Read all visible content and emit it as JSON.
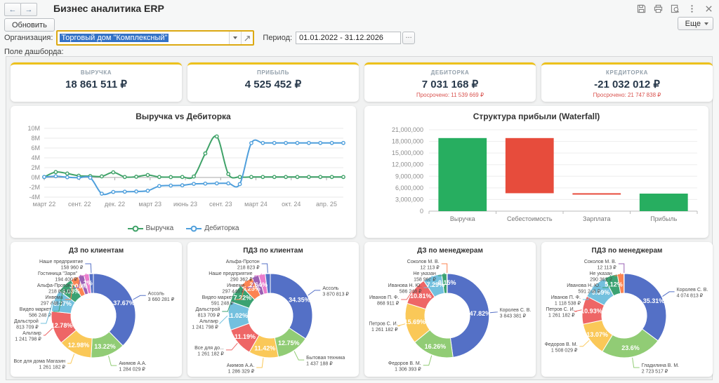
{
  "window": {
    "title": "Бизнес аналитика ERP",
    "back_glyph": "←",
    "forward_glyph": "→",
    "icons": [
      "save-icon",
      "print-icon",
      "preview-icon",
      "more-dots-icon",
      "close-icon"
    ]
  },
  "actions": {
    "refresh_label": "Обновить",
    "more_label": "Еще",
    "ellipsis_glyph": "..."
  },
  "filters": {
    "organization_label": "Организация:",
    "organization_value": "Торговый дом \"Комплексный\"",
    "period_label": "Период:",
    "period_value": "01.01.2022 - 31.12.2026"
  },
  "dashboard_area_label": "Поле дашборда:",
  "kpis": [
    {
      "label": "ВЫРУЧКА",
      "value": "18 861 511 ₽",
      "overdue": ""
    },
    {
      "label": "ПРИБЫЛЬ",
      "value": "4 525 452 ₽",
      "overdue": ""
    },
    {
      "label": "ДЕБИТОРКА",
      "value": "7 031 168 ₽",
      "overdue": "Просрочено: 11 539 669 ₽"
    },
    {
      "label": "КРЕДИТОРКА",
      "value": "-21 032 012 ₽",
      "overdue": "Просрочено: 21 747 838 ₽"
    }
  ],
  "colors": {
    "accent_yellow": "#edc11c",
    "kpi_value": "#28394b",
    "overdue_red": "#d9534f",
    "positive_green": "#27ae60",
    "negative_red": "#e74c3c",
    "line_green": "#3fa268",
    "line_blue": "#4f9fdc",
    "palette": [
      "#5470c6",
      "#91cc75",
      "#fac858",
      "#ee6666",
      "#73c0de",
      "#3ba272",
      "#fc8452",
      "#9a60b4",
      "#ea7ccc"
    ]
  },
  "chart_data": [
    {
      "type": "line",
      "title": "Выручка vs Дебиторка",
      "unit": "millions ₽",
      "ylim": [
        -4,
        10
      ],
      "y_ticks": [
        10,
        8,
        6,
        4,
        2,
        0,
        -2,
        -4
      ],
      "x_tick_labels": [
        "март 22",
        "сент. 22",
        "дек. 22",
        "март 23",
        "июнь 23",
        "сент. 23",
        "март 24",
        "окт. 24",
        "апр. 25"
      ],
      "legend_position": "bottom",
      "series": [
        {
          "name": "Выручка",
          "color_key": "line_green",
          "values": [
            0.1,
            1.1,
            0.8,
            0.35,
            0.28,
            0.22,
            1.05,
            0.1,
            0.15,
            0.5,
            0.1,
            0.08,
            0.1,
            0.2,
            4.9,
            8.35,
            0.7,
            0.1,
            0.1,
            0.1,
            0.1,
            0.1,
            0.1,
            0.1,
            0.1,
            0.1,
            0.1
          ]
        },
        {
          "name": "Дебиторка",
          "color_key": "line_blue",
          "values": [
            0.1,
            0.25,
            0.05,
            -0.05,
            -0.05,
            -3.3,
            -2.95,
            -2.9,
            -2.85,
            -2.7,
            -1.75,
            -1.65,
            -1.6,
            -1.3,
            -1.25,
            -1.2,
            -1.2,
            -1.35,
            7.0,
            7.03,
            7.03,
            7.03,
            7.03,
            7.03,
            7.03,
            7.03,
            7.03
          ]
        }
      ]
    },
    {
      "type": "bar",
      "subtype": "waterfall",
      "title": "Структура прибыли (Waterfall)",
      "categories": [
        "Выручка",
        "Себестоимость",
        "Зарплата",
        "Прибыль"
      ],
      "ylim": [
        0,
        21000000
      ],
      "y_tick_step": 3000000,
      "segments": [
        {
          "category": "Выручка",
          "from": 0,
          "to": 18861511,
          "role": "positive"
        },
        {
          "category": "Себестоимость",
          "from": 4625452,
          "to": 18861511,
          "role": "negative"
        },
        {
          "category": "Зарплата",
          "from": 4525452,
          "to": 4625452,
          "role": "negative"
        },
        {
          "category": "Прибыль",
          "from": 0,
          "to": 4525452,
          "role": "positive"
        }
      ]
    },
    {
      "type": "pie",
      "subtype": "donut",
      "title": "ДЗ по клиентам",
      "slices": [
        {
          "name": "Ассоль",
          "value": "3 660 281 ₽",
          "amount": 3660281,
          "pct_label": "37.67%"
        },
        {
          "name": "Акимов А.А.",
          "value": "1 284 029 ₽",
          "amount": 1284029,
          "pct_label": "13.22%"
        },
        {
          "name": "Все для дома Магазин",
          "value": "1 261 182 ₽",
          "amount": 1261182,
          "pct_label": "12.98%"
        },
        {
          "name": "Альтаир",
          "value": "1 241 798 ₽",
          "amount": 1241798,
          "pct_label": "12.78%"
        },
        {
          "name": "Дальстрой",
          "value": "813 709 ₽",
          "amount": 813709,
          "pct_label": "8.37%"
        },
        {
          "name": "Видео маркет",
          "value": "586 248 ₽",
          "amount": 586248,
          "pct_label": "6.03%"
        },
        {
          "name": "Инвема",
          "value": "297 448 ₽",
          "amount": 297448,
          "pct_label": "3.06%"
        },
        {
          "name": "Альфа-Протон",
          "value": "218 823 ₽",
          "amount": 218823,
          "pct_label": ""
        },
        {
          "name": "Гостиница \"Заря\"",
          "value": "194 400 ₽",
          "amount": 194400,
          "pct_label": "2%"
        },
        {
          "name": "Наше предприятие",
          "value": "158 960 ₽",
          "amount": 158960,
          "pct_label": ""
        }
      ]
    },
    {
      "type": "pie",
      "subtype": "donut",
      "title": "ПДЗ по клиентам",
      "slices": [
        {
          "name": "Ассоль",
          "value": "3 870 813 ₽",
          "amount": 3870813,
          "pct_label": "34.35%"
        },
        {
          "name": "Бытовая техника",
          "value": "1 437 188 ₽",
          "amount": 1437188,
          "pct_label": "12.75%"
        },
        {
          "name": "Акимов А.А.",
          "value": "1 286 329 ₽",
          "amount": 1286329,
          "pct_label": "11.42%"
        },
        {
          "name": "Все для до...",
          "value": "1 261 182 ₽",
          "amount": 1261182,
          "pct_label": "11.19%"
        },
        {
          "name": "Альтаир",
          "value": "1 241 798 ₽",
          "amount": 1241798,
          "pct_label": "11.02%"
        },
        {
          "name": "Дальстрой",
          "value": "813 709 ₽",
          "amount": 813709,
          "pct_label": "7.22%"
        },
        {
          "name": "Видео маркет",
          "value": "591 248 ₽",
          "amount": 591248,
          "pct_label": "5.25%"
        },
        {
          "name": "Инвема",
          "value": "297 448 ₽",
          "amount": 297448,
          "pct_label": "2.64%"
        },
        {
          "name": "Наше предприятие",
          "value": "290 362 ₽",
          "amount": 290362,
          "pct_label": ""
        },
        {
          "name": "Альфа-Протон",
          "value": "218 823 ₽",
          "amount": 218823,
          "pct_label": ""
        }
      ]
    },
    {
      "type": "pie",
      "subtype": "donut",
      "title": "ДЗ по менеджерам",
      "slices": [
        {
          "name": "Королев С. В.",
          "value": "3 843 381 ₽",
          "amount": 3843381,
          "pct_label": "47.82%"
        },
        {
          "name": "Федоров В. М.",
          "value": "1 306 393 ₽",
          "amount": 1306393,
          "pct_label": "16.26%"
        },
        {
          "name": "Петров С. И.",
          "value": "1 261 182 ₽",
          "amount": 1261182,
          "pct_label": "15.69%"
        },
        {
          "name": "Иванов П. Ф.",
          "value": "868 911 ₽",
          "amount": 868911,
          "pct_label": "10.81%"
        },
        {
          "name": "Иванова Н. Ю.",
          "value": "586 248 ₽",
          "amount": 586248,
          "pct_label": "7.29%"
        },
        {
          "name": "Не указан",
          "value": "158 960 ₽",
          "amount": 158960,
          "pct_label": ""
        },
        {
          "name": "Соколов М. В.",
          "value": "12 113 ₽",
          "amount": 12113,
          "pct_label": "0.15%"
        }
      ]
    },
    {
      "type": "pie",
      "subtype": "donut",
      "title": "ПДЗ по менеджерам",
      "slices": [
        {
          "name": "Королев С. В.",
          "value": "4 074 813 ₽",
          "amount": 4074813,
          "pct_label": "35.31%"
        },
        {
          "name": "Гладилина В. М.",
          "value": "2 723 517 ₽",
          "amount": 2723517,
          "pct_label": "23.6%"
        },
        {
          "name": "Федоров В. М.",
          "value": "1 508 029 ₽",
          "amount": 1508029,
          "pct_label": "13.07%"
        },
        {
          "name": "Петров С. И.",
          "value": "1 261 182 ₽",
          "amount": 1261182,
          "pct_label": "10.93%"
        },
        {
          "name": "Иванов П. Ф.",
          "value": "1 118 538 ₽",
          "amount": 1118538,
          "pct_label": "9.69%"
        },
        {
          "name": "Иванова Н. Ю.",
          "value": "591 248 ₽",
          "amount": 591248,
          "pct_label": "5.12%"
        },
        {
          "name": "Не указан",
          "value": "290 362 ₽",
          "amount": 290362,
          "pct_label": ""
        },
        {
          "name": "Соколов М. В.",
          "value": "12 113 ₽",
          "amount": 12113,
          "pct_label": ""
        }
      ]
    }
  ]
}
